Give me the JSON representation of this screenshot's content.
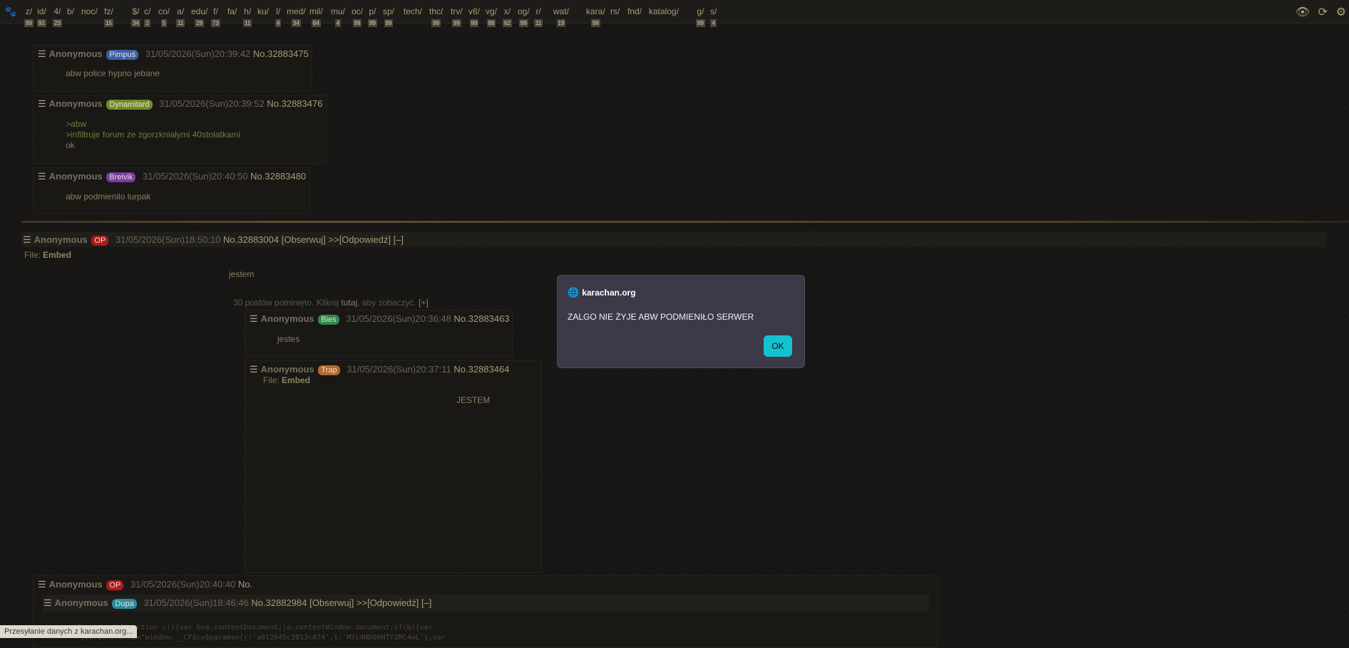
{
  "topbar": {
    "boards": [
      {
        "name": "z/",
        "count": "99"
      },
      {
        "name": "id/",
        "count": "91"
      },
      {
        "name": "4/",
        "count": "23"
      },
      {
        "name": "b/",
        "count": ""
      },
      {
        "name": "noc/",
        "count": ""
      },
      {
        "name": "fz/",
        "count": "15"
      },
      {
        "name": "$/",
        "count": "34"
      },
      {
        "name": "c/",
        "count": "2"
      },
      {
        "name": "co/",
        "count": "5"
      },
      {
        "name": "a/",
        "count": "11"
      },
      {
        "name": "edu/",
        "count": "29"
      },
      {
        "name": "f/",
        "count": "73"
      },
      {
        "name": "fa/",
        "count": ""
      },
      {
        "name": "h/",
        "count": "11"
      },
      {
        "name": "ku/",
        "count": ""
      },
      {
        "name": "l/",
        "count": "4"
      },
      {
        "name": "med/",
        "count": "34"
      },
      {
        "name": "mil/",
        "count": "64"
      },
      {
        "name": "mu/",
        "count": "4"
      },
      {
        "name": "oc/",
        "count": "99"
      },
      {
        "name": "p/",
        "count": "99"
      },
      {
        "name": "sp/",
        "count": "99"
      },
      {
        "name": "tech/",
        "count": ""
      },
      {
        "name": "thc/",
        "count": "99"
      },
      {
        "name": "trv/",
        "count": "99"
      },
      {
        "name": "v8/",
        "count": "99"
      },
      {
        "name": "vg/",
        "count": "99"
      },
      {
        "name": "x/",
        "count": "62"
      },
      {
        "name": "og/",
        "count": "99"
      },
      {
        "name": "r/",
        "count": "11"
      },
      {
        "name": "wat/",
        "count": "19"
      },
      {
        "name": "kara/",
        "count": "99"
      },
      {
        "name": "rs/",
        "count": ""
      },
      {
        "name": "fnd/",
        "count": ""
      },
      {
        "name": "katalog/",
        "count": ""
      },
      {
        "name": "g/",
        "count": "99"
      },
      {
        "name": "s/",
        "count": "4"
      }
    ],
    "icons": [
      "eye-icon",
      "refresh-icon",
      "gear-icon"
    ]
  },
  "posts": [
    {
      "name": "Anonymous",
      "tag": "Pimpuś",
      "tag_color": "#3f5fa8",
      "date": "31/05/2026(Sun)20:39:42",
      "no": "No.32883475",
      "lines": [
        "abw police hypno jebane"
      ]
    },
    {
      "name": "Anonymous",
      "tag": "Dynamitard",
      "tag_color": "#6f8c2a",
      "date": "31/05/2026(Sun)20:39:52",
      "no": "No.32883476",
      "lines": [
        ">abw",
        ">infiltruje forum ze zgorzkniałymi 40stolatkami",
        "ok"
      ]
    },
    {
      "name": "Anonymous",
      "tag": "Breivik",
      "tag_color": "#7a3aa0",
      "date": "31/05/2026(Sun)20:40:50",
      "no": "No.32883480",
      "lines": [
        "abw podmienilo lurpak"
      ]
    }
  ],
  "thread": {
    "op": {
      "name": "Anonymous",
      "tag": "OP",
      "tag_color": "#b01a1a",
      "date": "31/05/2026(Sun)18:50:10",
      "no": "No.32883004",
      "watch": "[Obserwuj]",
      "reply_prefix": ">>",
      "reply": "[Odpowiedź]",
      "collapse": "[–]"
    },
    "file_label": "File:",
    "file_value": "Embed",
    "message": "jestem",
    "omitted": {
      "before": "30 postów pominięto. Kliknij",
      "link": "tutaj",
      "after": ", aby zobaczyć.",
      "expand": "[+]"
    },
    "replies": [
      {
        "name": "Anonymous",
        "tag": "Bies",
        "tag_color": "#2f8a4a",
        "date": "31/05/2026(Sun)20:36:48",
        "no": "No.32883463",
        "message": "jestes"
      },
      {
        "name": "Anonymous",
        "tag": "Trap",
        "tag_color": "#b4692e",
        "date": "31/05/2026(Sun)20:37:11",
        "no": "No.32883464",
        "file_label": "File:",
        "file_value": "Embed",
        "message": "JESTEM"
      }
    ],
    "bottom_op": {
      "name": "Anonymous",
      "tag": "OP",
      "tag_color": "#b01a1a",
      "date": "31/05/2026(Sun)20:40:40",
      "no": "No."
    },
    "quoted": {
      "name": "Anonymous",
      "tag": "Dupa",
      "tag_color": "#2a8c9a",
      "date": "31/05/2026(Sun)18:46:46",
      "no": "No.32882984",
      "watch": "[Obserwuj]",
      "reply_prefix": ">>",
      "reply": "[Odpowiedź]",
      "collapse": "[–]"
    },
    "code_line1": "(function(){function c(){var b=a.contentDocument||a.contentWindow.document;if(b){var",
    "code_line2": "  ):d.innerHTML=\"window.__CF$cv$params={r:'a012645c3813c074',t:'MTc4NDQ0NTY2MC4wL'};var"
  },
  "status_text": "Przesyłanie danych z karachan.org...",
  "dialog": {
    "origin": "karachan.org",
    "message": "ZALGO NIE ŻYJE ABW PODMIENIŁO SERWER",
    "ok_label": "OK"
  }
}
